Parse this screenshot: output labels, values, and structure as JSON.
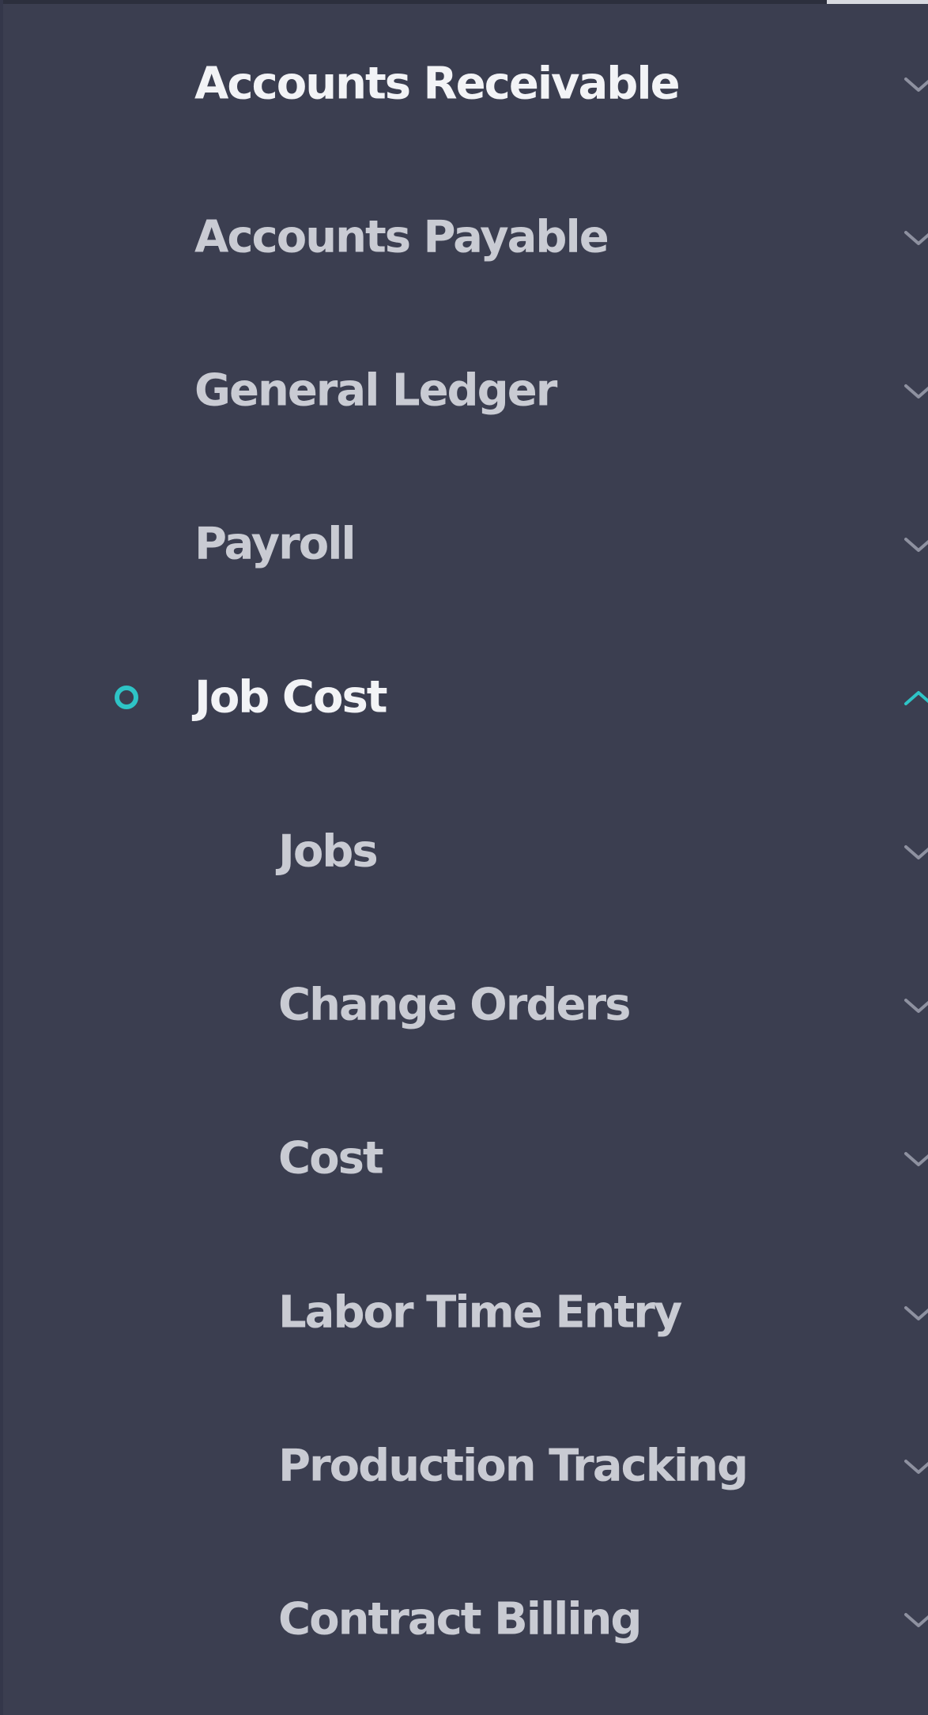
{
  "colors": {
    "sidebar_bg": "#3b3e50",
    "text_primary": "#f2f3f6",
    "text_secondary": "#c9cbd3",
    "accent": "#2ec4c6"
  },
  "menu": {
    "items": [
      {
        "label": "Accounts Receivable",
        "icon": "chevron-down-icon"
      },
      {
        "label": "Accounts Payable",
        "icon": "chevron-down-icon"
      },
      {
        "label": "General Ledger",
        "icon": "chevron-down-icon"
      },
      {
        "label": "Payroll",
        "icon": "chevron-down-icon"
      },
      {
        "label": "Job Cost",
        "icon": "chevron-up-icon",
        "active": true,
        "bullet_icon": "circle-bullet-icon",
        "children": [
          {
            "label": "Jobs",
            "icon": "chevron-down-icon"
          },
          {
            "label": "Change Orders",
            "icon": "chevron-down-icon"
          },
          {
            "label": "Cost",
            "icon": "chevron-down-icon"
          },
          {
            "label": "Labor Time Entry",
            "icon": "chevron-down-icon"
          },
          {
            "label": "Production Tracking",
            "icon": "chevron-down-icon"
          },
          {
            "label": "Contract Billing",
            "icon": "chevron-down-icon"
          }
        ]
      }
    ]
  }
}
